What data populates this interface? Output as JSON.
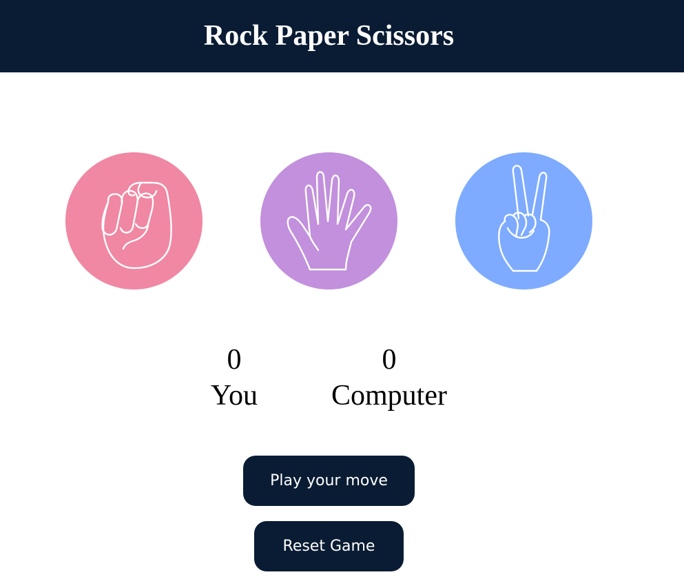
{
  "header": {
    "title": "Rock Paper Scissors"
  },
  "choices": [
    {
      "name": "rock",
      "icon": "fist-icon",
      "color": "#f087a3"
    },
    {
      "name": "paper",
      "icon": "open-hand-icon",
      "color": "#c290dc"
    },
    {
      "name": "scissors",
      "icon": "peace-sign-icon",
      "color": "#7eabff"
    }
  ],
  "scores": {
    "you": {
      "value": "0",
      "label": "You"
    },
    "computer": {
      "value": "0",
      "label": "Computer"
    }
  },
  "buttons": {
    "play_label": "Play your move",
    "reset_label": "Reset Game"
  },
  "colors": {
    "header_bg": "#0a1c33",
    "button_bg": "#0a1c33"
  }
}
